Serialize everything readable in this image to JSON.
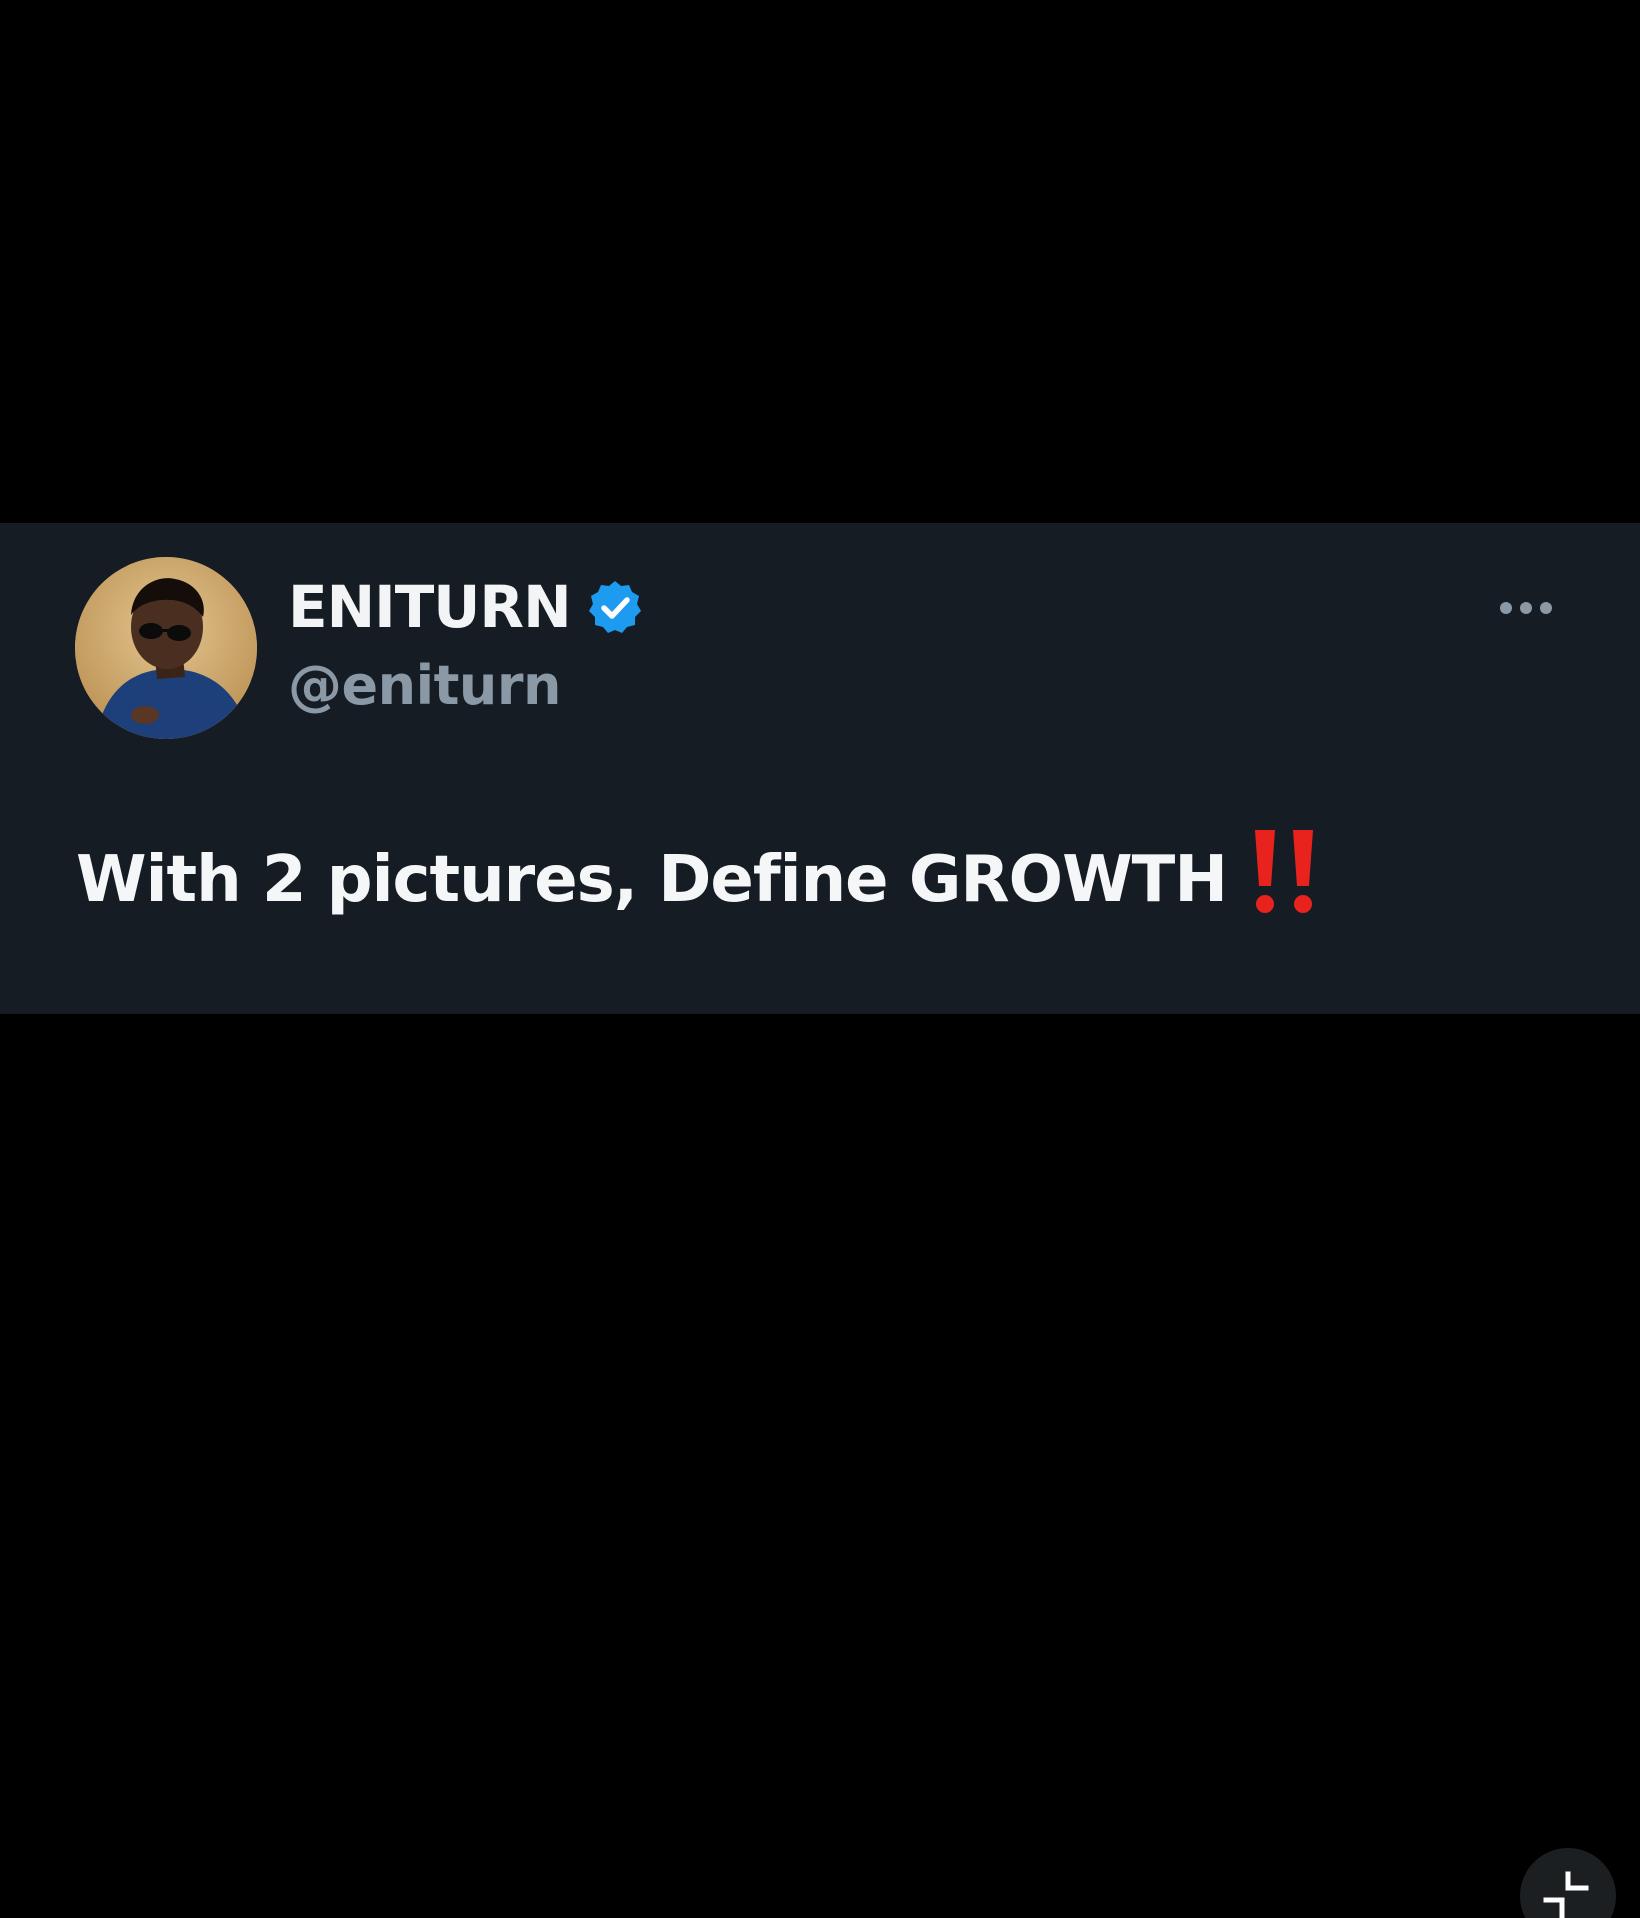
{
  "tweet": {
    "display_name": "ENITURN",
    "handle": "@eniturn",
    "text": "With 2 pictures, Define GROWTH",
    "emoji": "double-exclamation-emoji",
    "verified": true,
    "avatar": "profile-photo-avatar",
    "more_icon": "more-horizontal-icon"
  },
  "controls": {
    "corner_icon": "exit-fullscreen-icon"
  },
  "colors": {
    "background": "#000000",
    "card": "#161c23",
    "name": "#f2f4f5",
    "handle": "#8b98a5",
    "verified": "#1d9bf0",
    "emoji": "#e8231d"
  }
}
